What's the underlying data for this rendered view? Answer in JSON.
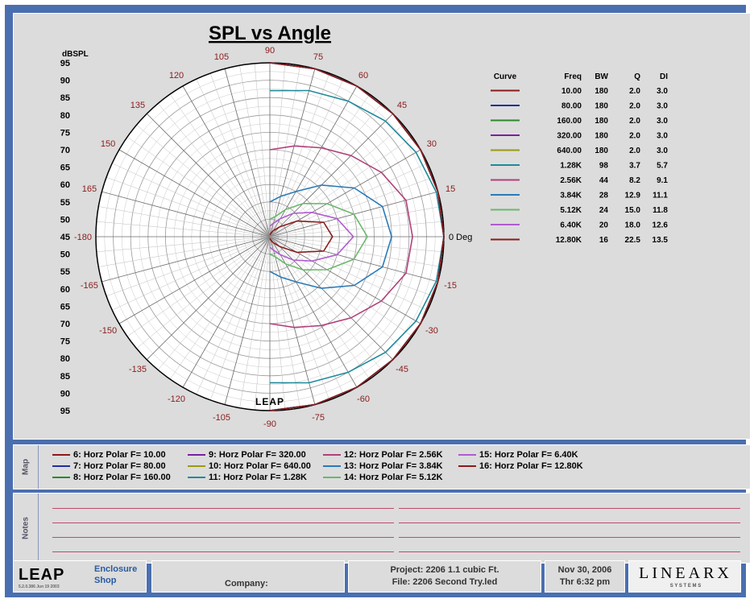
{
  "chart_data": {
    "type": "polar",
    "title": "SPL vs Angle",
    "radial_axis_label": "dBSPL",
    "radial_ticks": [
      "95",
      "90",
      "85",
      "80",
      "75",
      "70",
      "65",
      "60",
      "55",
      "50",
      "45",
      "50",
      "55",
      "60",
      "65",
      "70",
      "75",
      "80",
      "85",
      "90",
      "95"
    ],
    "angle_labels": [
      {
        "deg": 0,
        "text": "0 Deg"
      },
      {
        "deg": 15,
        "text": "15"
      },
      {
        "deg": 30,
        "text": "30"
      },
      {
        "deg": 45,
        "text": "45"
      },
      {
        "deg": 60,
        "text": "60"
      },
      {
        "deg": 75,
        "text": "75"
      },
      {
        "deg": 90,
        "text": "90"
      },
      {
        "deg": 105,
        "text": "105"
      },
      {
        "deg": 120,
        "text": "120"
      },
      {
        "deg": 135,
        "text": "135"
      },
      {
        "deg": 150,
        "text": "150"
      },
      {
        "deg": 165,
        "text": "165"
      },
      {
        "deg": 180,
        "text": "-180"
      },
      {
        "deg": -15,
        "text": "-15"
      },
      {
        "deg": -30,
        "text": "-30"
      },
      {
        "deg": -45,
        "text": "-45"
      },
      {
        "deg": -60,
        "text": "-60"
      },
      {
        "deg": -75,
        "text": "-75"
      },
      {
        "deg": -90,
        "text": "-90"
      },
      {
        "deg": -105,
        "text": "-105"
      },
      {
        "deg": -120,
        "text": "-120"
      },
      {
        "deg": -135,
        "text": "-135"
      },
      {
        "deg": -150,
        "text": "-150"
      },
      {
        "deg": -165,
        "text": "-165"
      }
    ],
    "rlim": [
      45,
      95
    ],
    "legend_headers": [
      "Curve",
      "Freq",
      "BW",
      "Q",
      "DI"
    ],
    "series": [
      {
        "freq": "10.00",
        "bw": "180",
        "q": "2.0",
        "di": "3.0",
        "color": "#8b1a1a",
        "angles": [
          0,
          15,
          30,
          45,
          60,
          75,
          90
        ],
        "spl": [
          95,
          95,
          95,
          95,
          95,
          95,
          95
        ]
      },
      {
        "freq": "80.00",
        "bw": "180",
        "q": "2.0",
        "di": "3.0",
        "color": "#1f2fa0",
        "angles": [
          0,
          15,
          30,
          45,
          60,
          75,
          90
        ],
        "spl": [
          95,
          95,
          95,
          95,
          95,
          95,
          95
        ]
      },
      {
        "freq": "160.00",
        "bw": "180",
        "q": "2.0",
        "di": "3.0",
        "color": "#2a8a2a",
        "angles": [
          0,
          15,
          30,
          45,
          60,
          75,
          90
        ],
        "spl": [
          95,
          95,
          95,
          95,
          95,
          95,
          95
        ]
      },
      {
        "freq": "320.00",
        "bw": "180",
        "q": "2.0",
        "di": "3.0",
        "color": "#7a1fa0",
        "angles": [
          0,
          15,
          30,
          45,
          60,
          75,
          90
        ],
        "spl": [
          95,
          95,
          95,
          95,
          95,
          95,
          95
        ]
      },
      {
        "freq": "640.00",
        "bw": "180",
        "q": "2.0",
        "di": "3.0",
        "color": "#9a9a10",
        "angles": [
          0,
          15,
          30,
          45,
          60,
          75,
          90
        ],
        "spl": [
          95,
          95,
          95,
          95,
          95,
          95,
          95
        ]
      },
      {
        "freq": "1.28K",
        "bw": "98",
        "q": "3.7",
        "di": "5.7",
        "color": "#1f8a9a",
        "angles": [
          0,
          15,
          30,
          45,
          60,
          75,
          90
        ],
        "spl": [
          95,
          94.5,
          93.5,
          92,
          90,
          88.5,
          87
        ]
      },
      {
        "freq": "2.56K",
        "bw": "44",
        "q": "8.2",
        "di": "9.1",
        "color": "#b0407a",
        "angles": [
          0,
          15,
          30,
          45,
          60,
          75,
          90
        ],
        "spl": [
          86,
          85.5,
          82,
          78,
          74.5,
          72,
          70
        ]
      },
      {
        "freq": "3.84K",
        "bw": "28",
        "q": "12.9",
        "di": "11.1",
        "color": "#2a7ab8",
        "angles": [
          0,
          15,
          30,
          45,
          60,
          75,
          90
        ],
        "spl": [
          80,
          78.5,
          73,
          66,
          60,
          57,
          55
        ]
      },
      {
        "freq": "5.12K",
        "bw": "24",
        "q": "15.0",
        "di": "11.8",
        "color": "#6ab86a",
        "angles": [
          0,
          15,
          30,
          45,
          60,
          75,
          90
        ],
        "spl": [
          73,
          70,
          64,
          58.5,
          54,
          51,
          50
        ]
      },
      {
        "freq": "6.40K",
        "bw": "20",
        "q": "18.0",
        "di": "12.6",
        "color": "#b05ad0",
        "angles": [
          0,
          15,
          30,
          45,
          60,
          75,
          90
        ],
        "spl": [
          69,
          65,
          59,
          54.5,
          51,
          49,
          48
        ]
      },
      {
        "freq": "12.80K",
        "bw": "16",
        "q": "22.5",
        "di": "13.5",
        "color": "#8b1a1a",
        "angles": [
          0,
          15,
          30,
          45,
          60,
          75,
          90
        ],
        "spl": [
          63,
          61,
          54,
          49,
          47,
          46,
          45.5
        ]
      }
    ]
  },
  "map": {
    "label": "Map",
    "items": [
      {
        "text": "6: Horz Polar F=  10.00",
        "color": "#8b1a1a"
      },
      {
        "text": "7: Horz Polar F=  80.00",
        "color": "#1f2fa0"
      },
      {
        "text": "8: Horz Polar F= 160.00",
        "color": "#2a8a2a"
      },
      {
        "text": "9: Horz Polar F= 320.00",
        "color": "#7a1fa0"
      },
      {
        "text": "10: Horz Polar F= 640.00",
        "color": "#9a9a10"
      },
      {
        "text": "11: Horz Polar F=   1.28K",
        "color": "#1f8a9a"
      },
      {
        "text": "12: Horz Polar F=   2.56K",
        "color": "#b0407a"
      },
      {
        "text": "13: Horz Polar F=   3.84K",
        "color": "#2a7ab8"
      },
      {
        "text": "14: Horz Polar F=   5.12K",
        "color": "#6ab86a"
      },
      {
        "text": "15: Horz Polar F=   6.40K",
        "color": "#b05ad0"
      },
      {
        "text": "16: Horz Polar F=  12.80K",
        "color": "#8b1a1a"
      }
    ]
  },
  "notes": {
    "label": "Notes"
  },
  "footer": {
    "logo": "LEAP",
    "logo_sub": "5.2.0.386   Jun 19 2003",
    "product_line1": "Enclosure",
    "product_line2": "Shop",
    "company_label": "Company:",
    "project": "Project: 2206 1.1 cubic Ft.",
    "file": "File: 2206 Second Try.led",
    "date": "Nov 30, 2006",
    "time": "Thr  6:32 pm",
    "brand": "LINEARX",
    "brand_sub": "S Y S T E M S"
  },
  "watermark": "LEAP"
}
